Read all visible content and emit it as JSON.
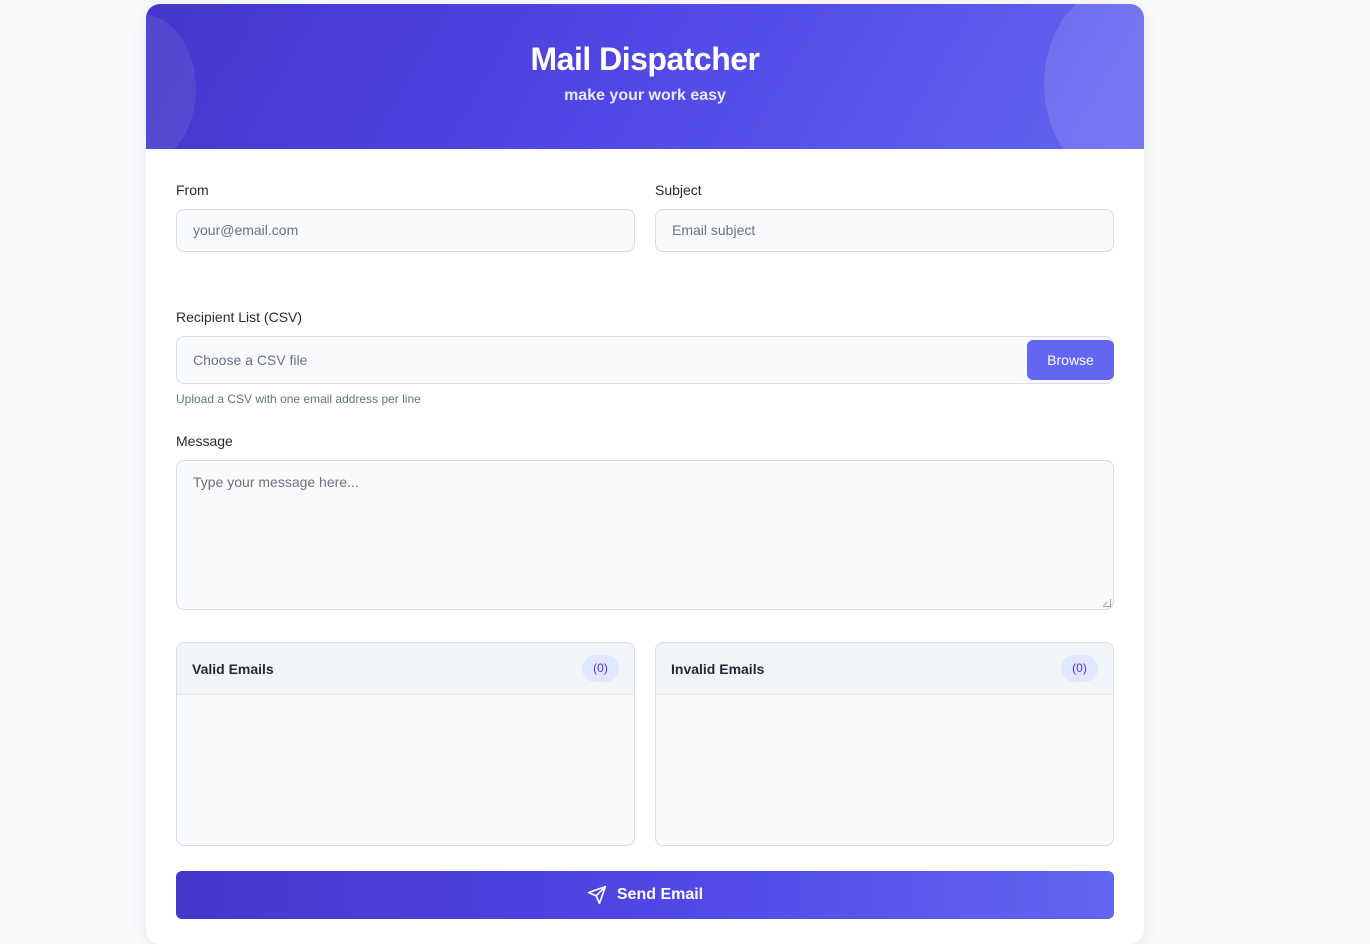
{
  "header": {
    "title": "Mail Dispatcher",
    "subtitle": "make your work easy"
  },
  "form": {
    "from": {
      "label": "From",
      "placeholder": "your@email.com"
    },
    "subject": {
      "label": "Subject",
      "placeholder": "Email subject"
    },
    "recipients": {
      "label": "Recipient List (CSV)",
      "placeholder": "Choose a CSV file",
      "browse_label": "Browse",
      "help": "Upload a CSV with one email address per line"
    },
    "message": {
      "label": "Message",
      "placeholder": "Type your message here..."
    }
  },
  "lists": {
    "valid": {
      "title": "Valid Emails",
      "count": "(0)"
    },
    "invalid": {
      "title": "Invalid Emails",
      "count": "(0)"
    }
  },
  "send": {
    "label": "Send Email",
    "icon": "paper-plane-icon"
  },
  "colors": {
    "accent": "#6366f1",
    "accent_dark": "#4338ca",
    "badge_bg": "#e0e7ff"
  }
}
